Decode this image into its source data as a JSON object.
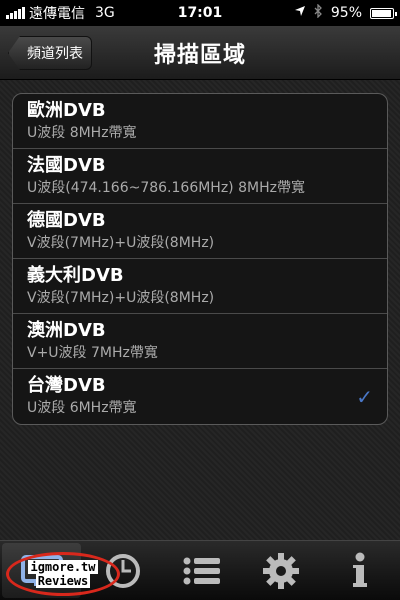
{
  "status_bar": {
    "carrier": "遠傳電信",
    "network": "3G",
    "time": "17:01",
    "battery": "95%",
    "battery_level": 0.95
  },
  "nav": {
    "back_label": "頻道列表",
    "title": "掃描區域"
  },
  "regions": [
    {
      "title": "歐洲DVB",
      "subtitle": "U波段 8MHz帶寬",
      "selected": false
    },
    {
      "title": "法國DVB",
      "subtitle": "U波段(474.166~786.166MHz) 8MHz帶寬",
      "selected": false
    },
    {
      "title": "德國DVB",
      "subtitle": "V波段(7MHz)+U波段(8MHz)",
      "selected": false
    },
    {
      "title": "義大利DVB",
      "subtitle": "V波段(7MHz)+U波段(8MHz)",
      "selected": false
    },
    {
      "title": "澳洲DVB",
      "subtitle": "V+U波段 7MHz帶寬",
      "selected": false
    },
    {
      "title": "台灣DVB",
      "subtitle": "U波段 6MHz帶寬",
      "selected": true
    }
  ],
  "check_glyph": "✓",
  "tabs": [
    {
      "icon": "tv-icon",
      "active": true
    },
    {
      "icon": "clock-icon",
      "active": false
    },
    {
      "icon": "list-icon",
      "active": false
    },
    {
      "icon": "gear-icon",
      "active": false
    },
    {
      "icon": "info-icon",
      "active": false
    }
  ],
  "watermark": {
    "line1": "igmore.tw",
    "line2": "Reviews",
    "color": "#d8281c"
  },
  "colors": {
    "check": "#4a78c8"
  }
}
